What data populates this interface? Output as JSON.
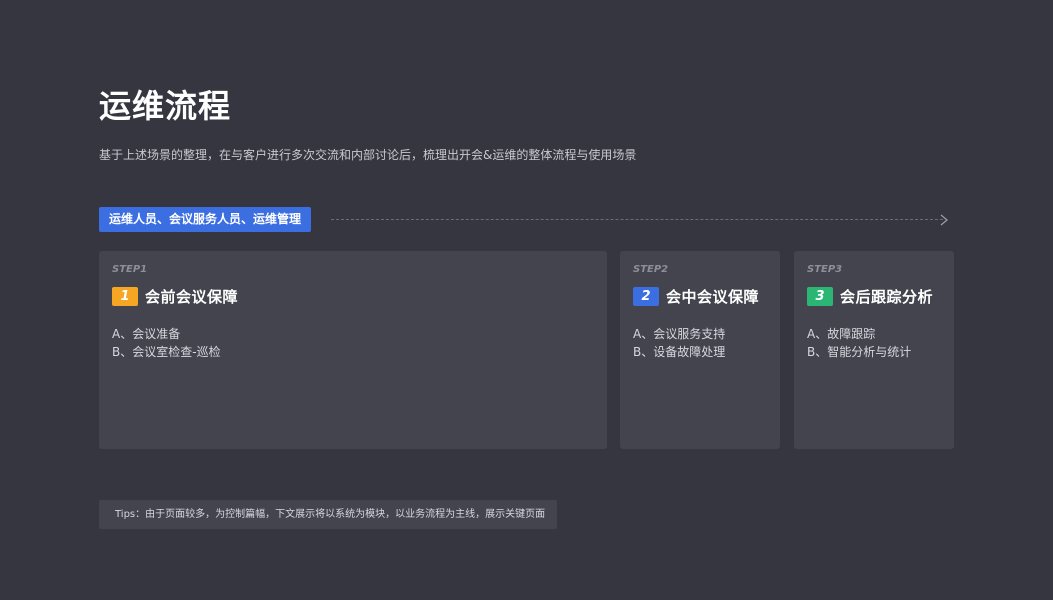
{
  "page": {
    "title": "运维流程",
    "subtitle": "基于上述场景的整理，在与客户进行多次交流和内部讨论后，梳理出开会&运维的整体流程与使用场景"
  },
  "roles_badge": {
    "label": "运维人员、会议服务人员、运维管理",
    "color": "#3b6ee0"
  },
  "steps": [
    {
      "step_label": "STEP1",
      "number": "1",
      "title": "会前会议保障",
      "badge_color": "#f6a623",
      "items": [
        "A、会议准备",
        "B、会议室检查-巡检"
      ]
    },
    {
      "step_label": "STEP2",
      "number": "2",
      "title": "会中会议保障",
      "badge_color": "#3b6ee0",
      "items": [
        "A、会议服务支持",
        "B、设备故障处理"
      ]
    },
    {
      "step_label": "STEP3",
      "number": "3",
      "title": "会后跟踪分析",
      "badge_color": "#2bb673",
      "items": [
        "A、故障跟踪",
        "B、智能分析与统计"
      ]
    }
  ],
  "tips": "Tips：由于页面较多，为控制篇幅，下文展示将以系统为模块，以业务流程为主线，展示关键页面",
  "icons": {
    "flow_arrow": "chevron-right-icon"
  }
}
